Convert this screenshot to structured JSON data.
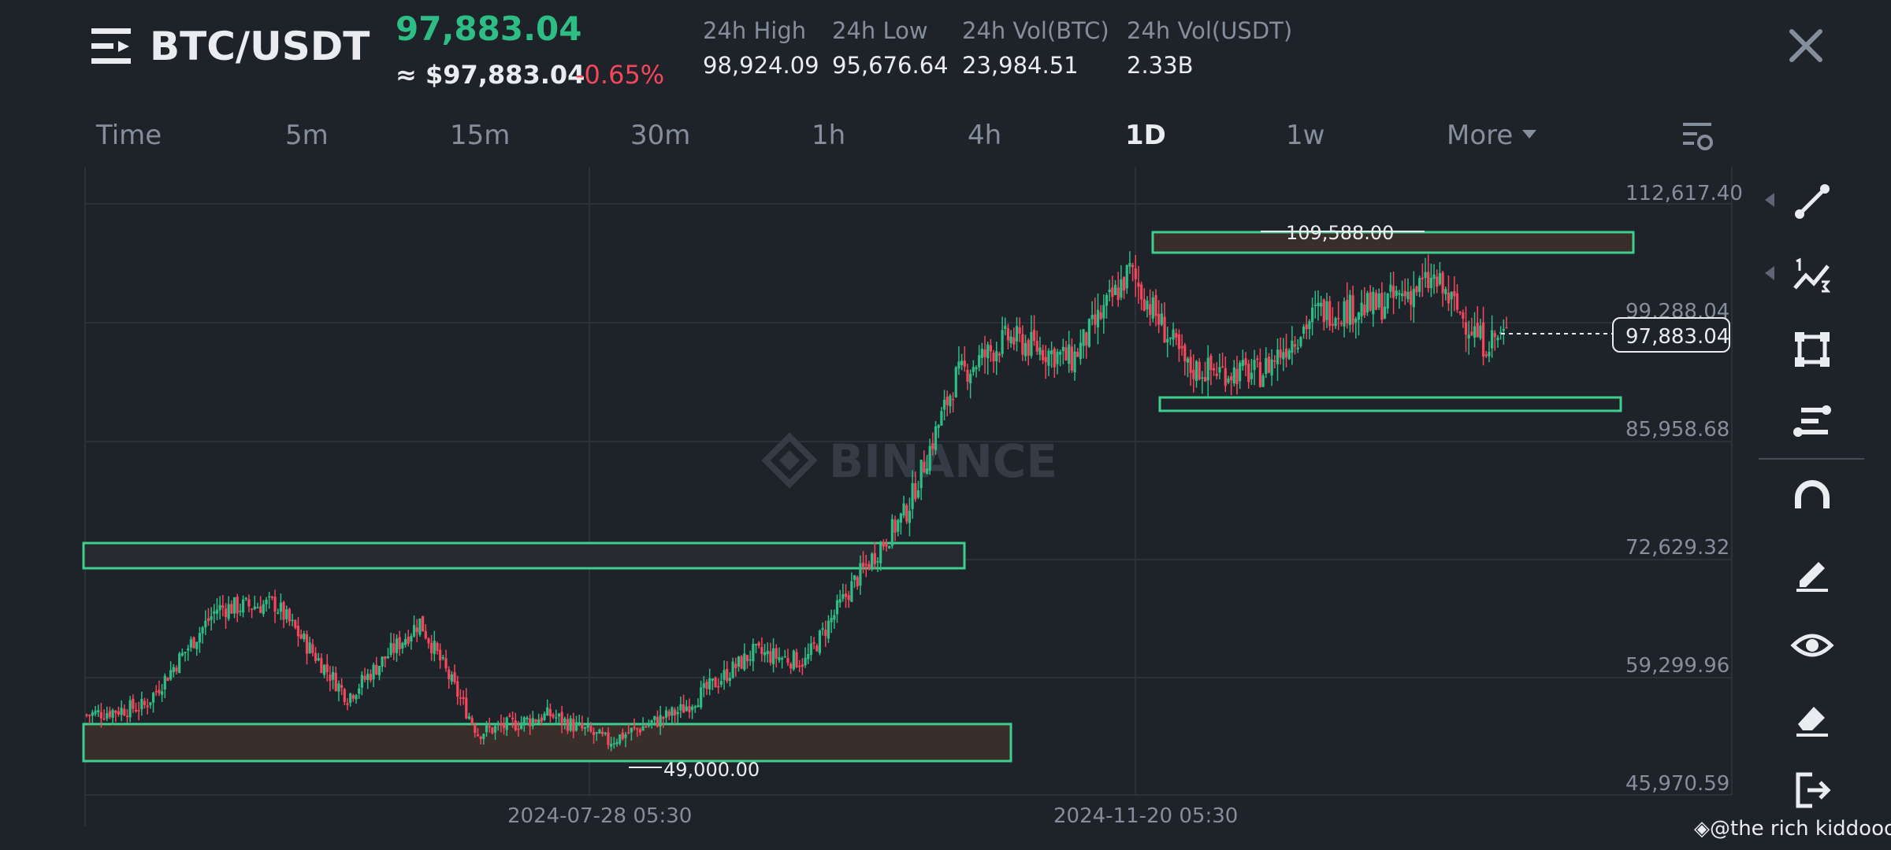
{
  "header": {
    "pair": "BTC/USDT",
    "last_price": "97,883.04",
    "usd_price": "≈ $97,883.04",
    "change": "-0.65%",
    "stats": [
      {
        "label": "24h High",
        "value": "98,924.09"
      },
      {
        "label": "24h Low",
        "value": "95,676.64"
      },
      {
        "label": "24h Vol(BTC)",
        "value": "23,984.51"
      },
      {
        "label": "24h Vol(USDT)",
        "value": "2.33B"
      }
    ]
  },
  "intervals": {
    "items": [
      "Time",
      "5m",
      "15m",
      "30m",
      "1h",
      "4h",
      "1D",
      "1w",
      "More"
    ],
    "active": "1D"
  },
  "chart": {
    "watermark": "BINANCE",
    "y_ticks": [
      "112,617.40",
      "99,288.04",
      "85,958.68",
      "72,629.32",
      "59,299.96",
      "45,970.59"
    ],
    "x_ticks": [
      "2024-07-28 05:30",
      "2024-11-20 05:30"
    ],
    "current_price_label": "97,883.04",
    "high_label": "109,588.00",
    "low_label": "49,000.00"
  },
  "chart_data": {
    "type": "candlestick",
    "title": "BTC/USDT 1D",
    "ylim": [
      45970.59,
      112617.4
    ],
    "x_ticks": [
      "2024-07-28 05:30",
      "2024-11-20 05:30"
    ],
    "grid": true,
    "last_price": 97883.04,
    "high_marker": 109588.0,
    "low_marker": 49000.0,
    "zones": [
      {
        "kind": "resistance",
        "from": 105800,
        "to": 108400
      },
      {
        "kind": "support",
        "from": 91500,
        "to": 93000
      },
      {
        "kind": "resistance",
        "from": 70800,
        "to": 73600
      },
      {
        "kind": "support",
        "from": 50300,
        "to": 54500
      }
    ],
    "trend_close_points": [
      [
        0,
        55000
      ],
      [
        20,
        56000
      ],
      [
        45,
        67000
      ],
      [
        65,
        67500
      ],
      [
        90,
        57000
      ],
      [
        115,
        65500
      ],
      [
        135,
        53000
      ],
      [
        160,
        55000
      ],
      [
        180,
        52000
      ],
      [
        205,
        55500
      ],
      [
        230,
        62000
      ],
      [
        248,
        61000
      ],
      [
        265,
        70000
      ],
      [
        283,
        78000
      ],
      [
        300,
        93000
      ],
      [
        318,
        97500
      ],
      [
        340,
        95000
      ],
      [
        360,
        105000
      ],
      [
        380,
        94000
      ],
      [
        405,
        93500
      ],
      [
        425,
        100500
      ],
      [
        445,
        101000
      ],
      [
        465,
        104000
      ],
      [
        482,
        97000
      ],
      [
        490,
        97883
      ]
    ]
  },
  "toolbar": {
    "icons": [
      "trend-line-icon",
      "multi-line-icon",
      "rectangle-icon",
      "fibonacci-icon",
      "magnet-icon",
      "pencil-icon",
      "eye-icon",
      "eraser-icon",
      "exit-icon"
    ]
  },
  "footer": {
    "credit": "@the rich kiddooo"
  },
  "colors": {
    "up": "#2ebd85",
    "down": "#f6465d",
    "background": "#1e2329",
    "zone_fill": "#3a2e2b",
    "zone_border": "#3ecf8e"
  }
}
